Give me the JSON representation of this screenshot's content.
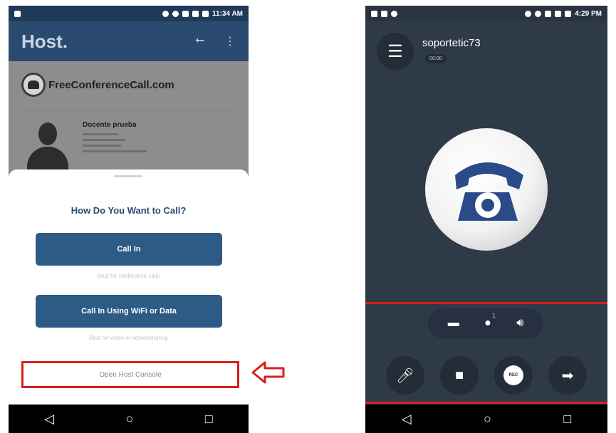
{
  "left_phone": {
    "status_time": "11:34 AM",
    "appbar_title": "Host.",
    "brand_text": "FreeConferenceCall.com",
    "card_name": "Docente prueba",
    "sheet": {
      "title": "How Do You Want to Call?",
      "call_in_label": "Call In",
      "call_in_hint": "Best for conference calls",
      "wifi_label": "Call In Using WiFi or Data",
      "wifi_hint": "Best for video or screensharing",
      "host_console_label": "Open Host Console"
    },
    "nav": {
      "back": "◁",
      "home": "○",
      "recents": "□"
    }
  },
  "right_phone": {
    "status_time": "4:29 PM",
    "caller": "soportetic73",
    "timer": "00:00",
    "participants_count": "1",
    "nav": {
      "back": "◁",
      "home": "○",
      "recents": "□"
    },
    "rec_label": "REC"
  },
  "colors": {
    "highlight": "#d62020",
    "brand_blue": "#2e5a86",
    "call_bg": "#2f3a48"
  }
}
